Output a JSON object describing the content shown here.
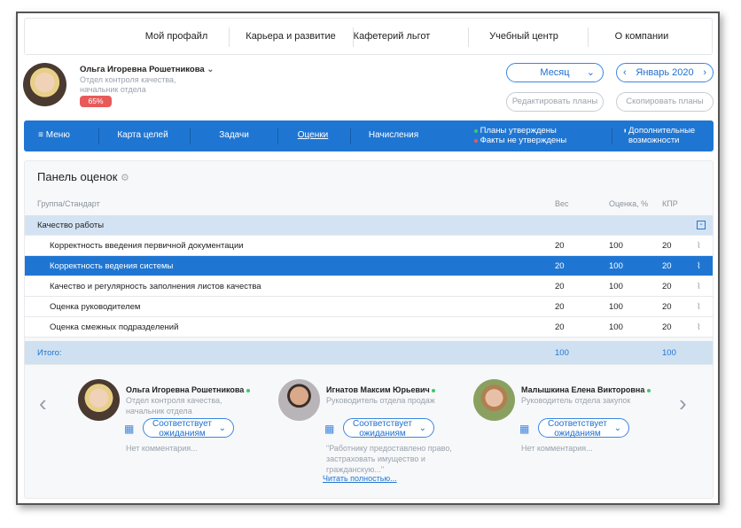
{
  "topnav": {
    "items": [
      "Мой профайл",
      "Карьера и развитие",
      "Кафетерий льгот",
      "Учебный центр",
      "О компании"
    ]
  },
  "profile": {
    "name": "Ольга Игоревна Рошетникова",
    "department": "Отдел контроля качества,",
    "position": "начальник отдела",
    "progress_label": "65%",
    "progress": 65
  },
  "controls": {
    "period": "Месяц",
    "month": "Январь 2020",
    "edit_plans": "Редактировать планы",
    "copy_plans": "Скопировать планы"
  },
  "menubar": {
    "menu": "Меню",
    "items": [
      "Карта целей",
      "Задачи",
      "Оценки",
      "Начисления"
    ],
    "active": "Оценки",
    "status_approved": "Планы утверждены",
    "status_not_approved": "Факты не утверждены",
    "more": "Дополнительные возможности",
    "colors": {
      "approved": "#3cc86a",
      "not_approved": "#e85a5a",
      "bar": "#1f76d2"
    }
  },
  "panel": {
    "title": "Панель оценок",
    "columns": {
      "group": "Группа/Стандарт",
      "weight": "Вес",
      "score": "Оценка, %",
      "kpr": "КПР"
    },
    "group": "Качество работы",
    "rows": [
      {
        "name": "Корректность введения первичной документации",
        "weight": "20",
        "score": "100",
        "kpr": "20"
      },
      {
        "name": "Корректность ведения системы",
        "weight": "20",
        "score": "100",
        "kpr": "20"
      },
      {
        "name": "Качество и регулярность заполнения листов качества",
        "weight": "20",
        "score": "100",
        "kpr": "20"
      },
      {
        "name": "Оценка руководителем",
        "weight": "20",
        "score": "100",
        "kpr": "20"
      },
      {
        "name": "Оценка смежных подразделений",
        "weight": "20",
        "score": "100",
        "kpr": "20"
      }
    ],
    "total": {
      "label": "Итого:",
      "weight": "100",
      "kpr": "100"
    }
  },
  "reviewers": [
    {
      "name": "Ольга Игоревна Рошетникова",
      "line1": "Отдел контроля качества,",
      "line2": "начальник отдела",
      "rating": "Соответствует ожиданиям",
      "comment": "Нет комментария..."
    },
    {
      "name": "Игнатов Максим Юрьевич",
      "line1": "Руководитель отдела продаж",
      "line2": "",
      "rating": "Соответствует ожиданиям",
      "comment": "\"Работнику предоставлено право, застраховать имущество и гражданскую...\"",
      "read_more": "Читать полностью..."
    },
    {
      "name": "Малышкина Елена Викторовна",
      "line1": "Руководитель отдела закупок",
      "line2": "",
      "rating": "Соответствует ожиданиям",
      "comment": "Нет комментария..."
    }
  ]
}
